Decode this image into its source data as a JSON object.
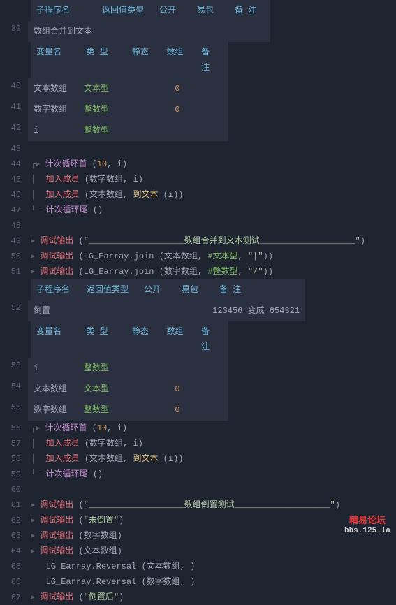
{
  "tableHeader1": {
    "col1": "子程序名",
    "col2": "返回值类型",
    "col3": "公开",
    "col4": "易包",
    "col5": "备 注"
  },
  "sub1": {
    "name": "数组合并到文本"
  },
  "varHeader": {
    "col1": "变量名",
    "col2": "类 型",
    "col3": "静态",
    "col4": "数组",
    "col5": "备 注"
  },
  "vars1": [
    {
      "name": "文本数组",
      "type": "文本型",
      "arr": "0"
    },
    {
      "name": "数字数组",
      "type": "整数型",
      "arr": "0"
    },
    {
      "name": "i",
      "type": "整数型",
      "arr": ""
    }
  ],
  "loop": {
    "head": "计次循环首",
    "tail": "计次循环尾",
    "count": "10",
    "var": "i"
  },
  "calls": {
    "addMember": "加入成员",
    "toText": "到文本",
    "debugOut": "调试输出",
    "lgEarray": "LG_Earray",
    "join": "join",
    "reversal": "Reversal"
  },
  "args": {
    "numArr": "数字数组",
    "txtArr": "文本数组",
    "i": "i"
  },
  "hashTypes": {
    "text": "#文本型",
    "int": "#整数型"
  },
  "strings": {
    "sep1": "\"|\"",
    "sep2": "\"/\"",
    "hdr1_l": "\"___________________数组合并到文本测试___________________\"",
    "hdr2_l": "\"___________________数组倒置测试___________________\"",
    "before": "\"未倒置\"",
    "after": "\"倒置后\""
  },
  "sub2": {
    "name": "倒置",
    "note": "123456 变成 654321"
  },
  "vars2": [
    {
      "name": "i",
      "type": "整数型",
      "arr": ""
    },
    {
      "name": "文本数组",
      "type": "文本型",
      "arr": "0"
    },
    {
      "name": "数字数组",
      "type": "整数型",
      "arr": "0"
    }
  ],
  "watermark": {
    "line1": "精易论坛",
    "line2": "bbs.125.la"
  },
  "linenos": {
    "l39": "39",
    "l40": "40",
    "l41": "41",
    "l42": "42",
    "l43": "43",
    "l44": "44",
    "l45": "45",
    "l46": "46",
    "l47": "47",
    "l48": "48",
    "l49": "49",
    "l50": "50",
    "l51": "51",
    "l52": "52",
    "l53": "53",
    "l54": "54",
    "l55": "55",
    "l56": "56",
    "l57": "57",
    "l58": "58",
    "l59": "59",
    "l60": "60",
    "l61": "61",
    "l62": "62",
    "l63": "63",
    "l64": "64",
    "l65": "65",
    "l66": "66",
    "l67": "67"
  }
}
